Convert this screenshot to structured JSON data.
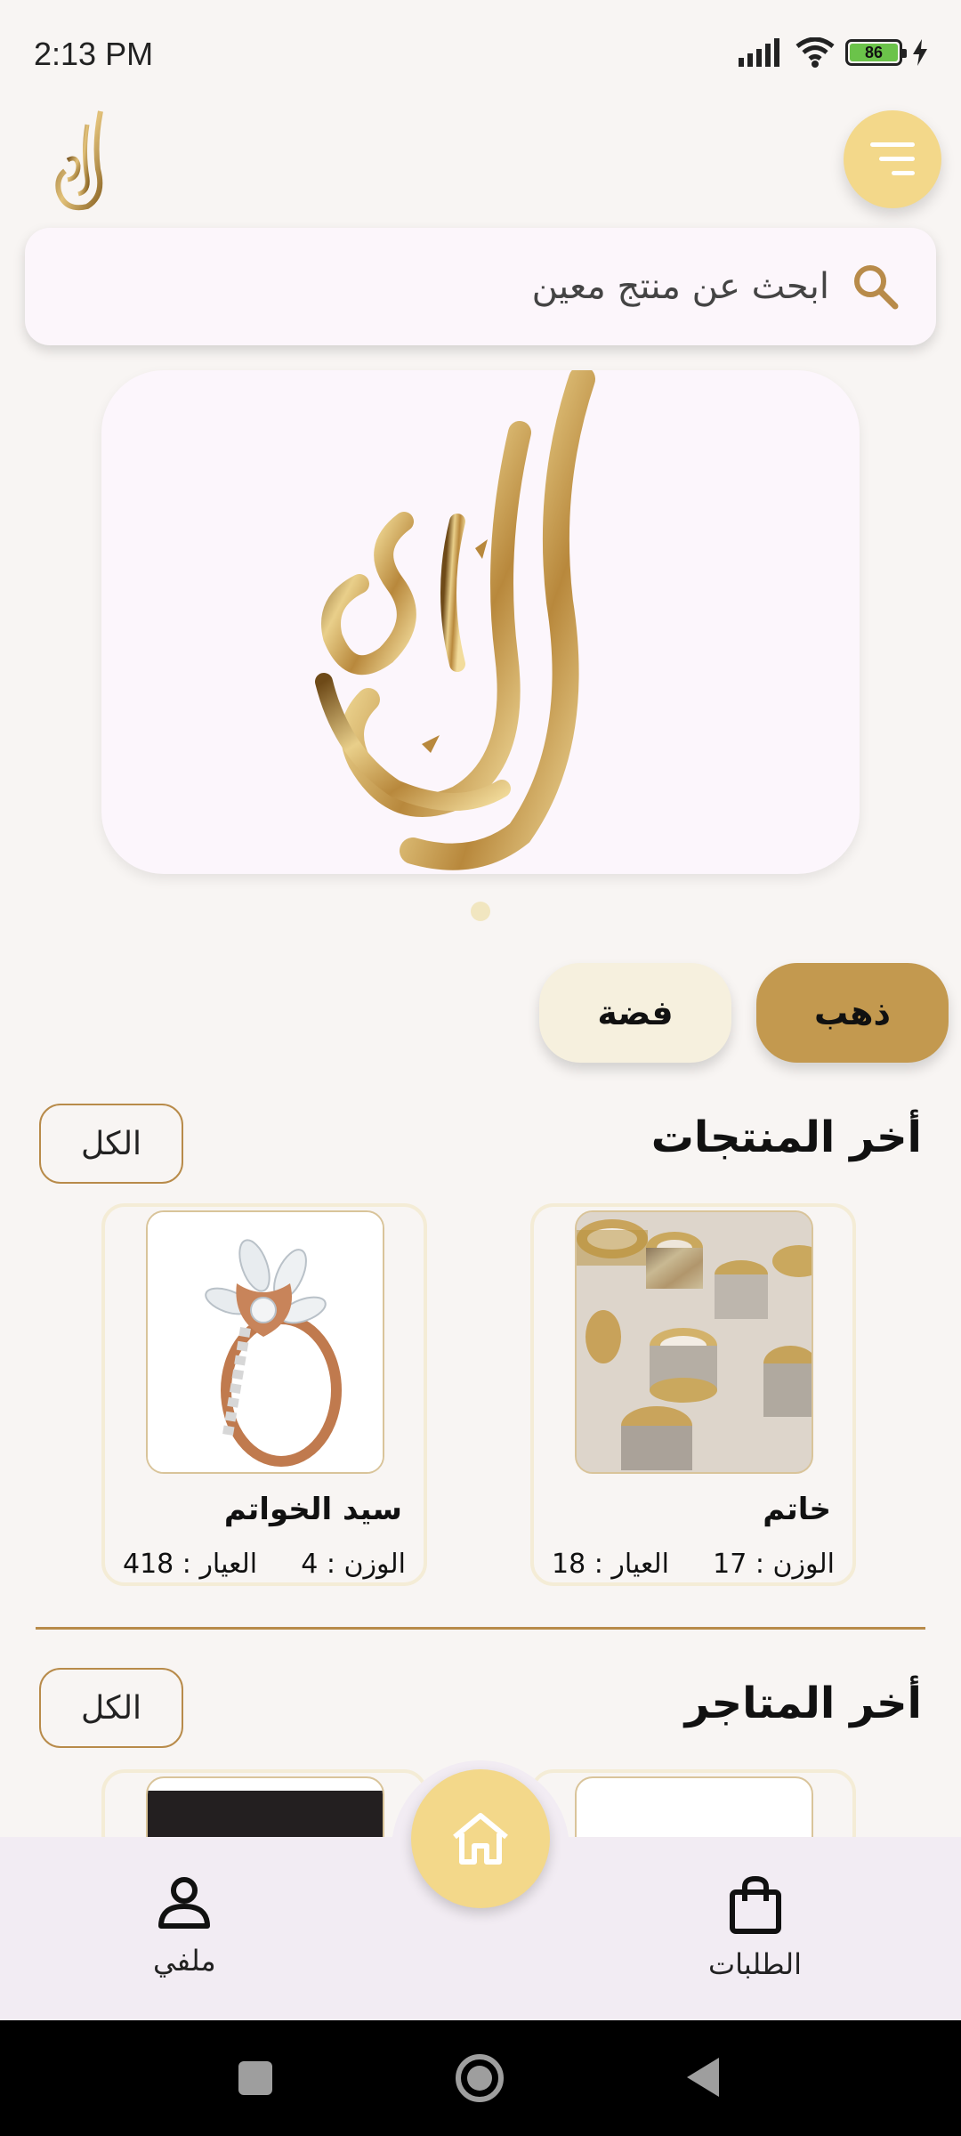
{
  "status_bar": {
    "time": "2:13 PM",
    "battery": "86"
  },
  "search": {
    "placeholder": "ابحث عن منتج معين"
  },
  "categories": [
    {
      "label": "ذهب",
      "selected": true
    },
    {
      "label": "فضة",
      "selected": false
    }
  ],
  "latest_products": {
    "title": "أخر المنتجات",
    "all_label": "الكل",
    "items": [
      {
        "name": "خاتم",
        "weight": "الوزن : 17",
        "karat": "العيار : 18"
      },
      {
        "name": "سيد الخواتم",
        "weight": "الوزن : 4",
        "karat": "العيار : 418"
      }
    ]
  },
  "latest_stores": {
    "title": "أخر المتاجر",
    "all_label": "الكل"
  },
  "bottom_nav": {
    "orders": "الطلبات",
    "profile": "ملفي"
  },
  "colors": {
    "accent": "#f3d88a",
    "gold": "#c3994f",
    "background": "#f8f5f3"
  },
  "icons": [
    "search-icon",
    "menu-icon",
    "home-icon",
    "bag-icon",
    "person-icon"
  ]
}
